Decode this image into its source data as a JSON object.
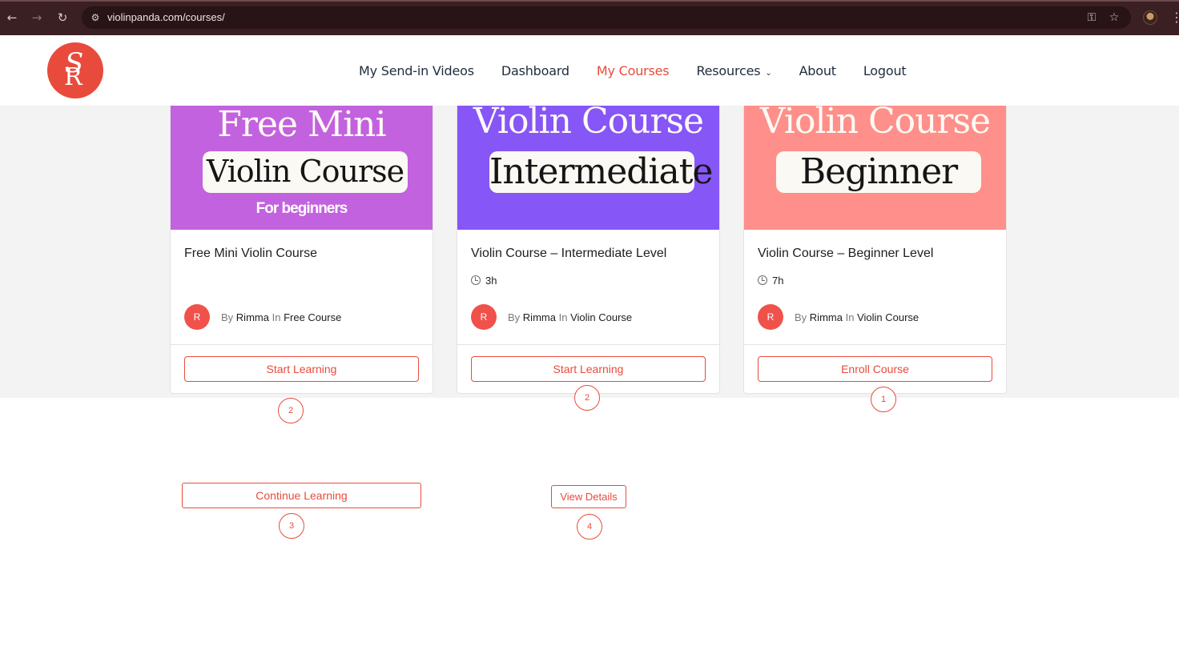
{
  "browser": {
    "url": "violinpanda.com/courses/",
    "icons": [
      "back-arrow-icon",
      "forward-arrow-icon",
      "reload-icon",
      "site-settings-icon",
      "password-key-icon",
      "bookmark-star-icon",
      "profile-avatar",
      "more-menu-icon"
    ]
  },
  "header": {
    "logo": "SR monogram",
    "nav": [
      {
        "label": "My Send-in Videos",
        "active": false
      },
      {
        "label": "Dashboard",
        "active": false
      },
      {
        "label": "My Courses",
        "active": true
      },
      {
        "label": "Resources",
        "active": false,
        "has_dropdown": true
      },
      {
        "label": "About",
        "active": false
      },
      {
        "label": "Logout",
        "active": false
      }
    ],
    "accent_color": "#e84b3c"
  },
  "courses": [
    {
      "thumb_line1": "Free Mini",
      "thumb_pill": "Violin Course",
      "thumb_sub": "For beginners",
      "thumb_color": "#c262de",
      "title": "Free Mini Violin Course",
      "duration": "",
      "avatar_initial": "R",
      "by_label": "By",
      "author": "Rimma",
      "in_label": "In",
      "category": "Free Course",
      "cta": "Start Learning",
      "badge": "2"
    },
    {
      "thumb_line1": "Violin Course",
      "thumb_pill": "Intermediate",
      "thumb_sub": "",
      "thumb_color": "#8656f7",
      "title": "Violin Course – Intermediate Level",
      "duration": "3h",
      "avatar_initial": "R",
      "by_label": "By",
      "author": "Rimma",
      "in_label": "In",
      "category": "Violin Course",
      "cta": "Start Learning",
      "badge": "2"
    },
    {
      "thumb_line1": "Violin Course",
      "thumb_pill": "Beginner",
      "thumb_sub": "",
      "thumb_color": "#ff8f8a",
      "title": "Violin Course – Beginner Level",
      "duration": "7h",
      "avatar_initial": "R",
      "by_label": "By",
      "author": "Rimma",
      "in_label": "In",
      "category": "Violin Course",
      "cta": "Enroll Course",
      "badge": "1"
    }
  ],
  "extra": {
    "continue_label": "Continue Learning",
    "continue_badge": "3",
    "view_details_label": "View Details",
    "view_details_badge": "4"
  }
}
